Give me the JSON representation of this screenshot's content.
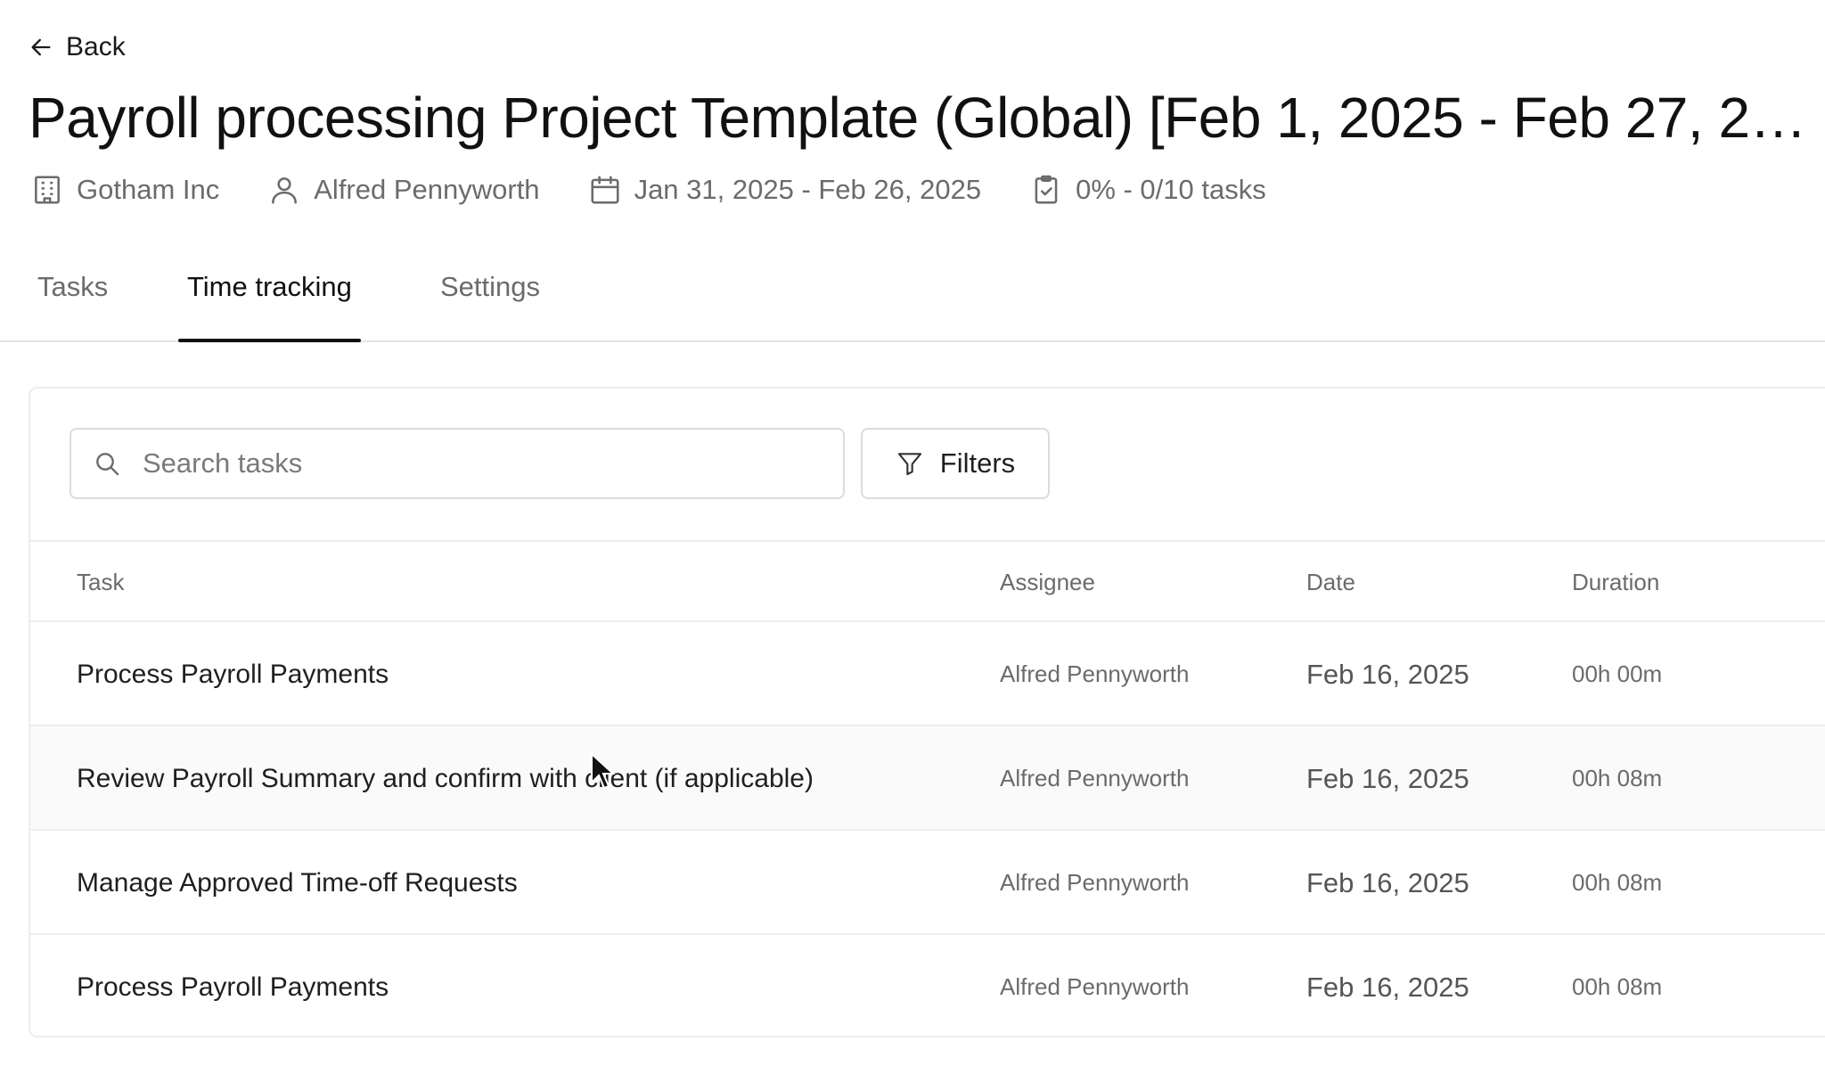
{
  "back": {
    "label": "Back"
  },
  "page": {
    "title": "Payroll processing Project Template (Global) [Feb 1, 2025 - Feb 27, 2…"
  },
  "meta": {
    "company": "Gotham Inc",
    "owner": "Alfred Pennyworth",
    "date_range": "Jan 31, 2025 - Feb 26, 2025",
    "progress": "0% - 0/10 tasks"
  },
  "tabs": [
    {
      "label": "Tasks",
      "active": false
    },
    {
      "label": "Time tracking",
      "active": true
    },
    {
      "label": "Settings",
      "active": false
    }
  ],
  "toolbar": {
    "search_placeholder": "Search tasks",
    "filters_label": "Filters"
  },
  "table": {
    "headers": {
      "task": "Task",
      "assignee": "Assignee",
      "date": "Date",
      "duration": "Duration"
    },
    "rows": [
      {
        "task": "Process Payroll Payments",
        "assignee": "Alfred Pennyworth",
        "date": "Feb 16, 2025",
        "duration": "00h 00m"
      },
      {
        "task": "Review Payroll Summary and confirm with client (if applicable)",
        "assignee": "Alfred Pennyworth",
        "date": "Feb 16, 2025",
        "duration": "00h 08m"
      },
      {
        "task": "Manage Approved Time-off Requests",
        "assignee": "Alfred Pennyworth",
        "date": "Feb 16, 2025",
        "duration": "00h 08m"
      },
      {
        "task": "Process Payroll Payments",
        "assignee": "Alfred Pennyworth",
        "date": "Feb 16, 2025",
        "duration": "00h 08m"
      }
    ]
  },
  "icons": {
    "back": "arrow-left-icon",
    "company": "building-icon",
    "owner": "user-icon",
    "date": "calendar-icon",
    "progress": "clipboard-check-icon",
    "search": "search-icon",
    "filters": "filter-icon"
  },
  "colors": {
    "text_primary": "#1a1a1a",
    "text_secondary": "#6b6b6b",
    "border": "#ededed",
    "active_tab_indicator": "#111111"
  }
}
